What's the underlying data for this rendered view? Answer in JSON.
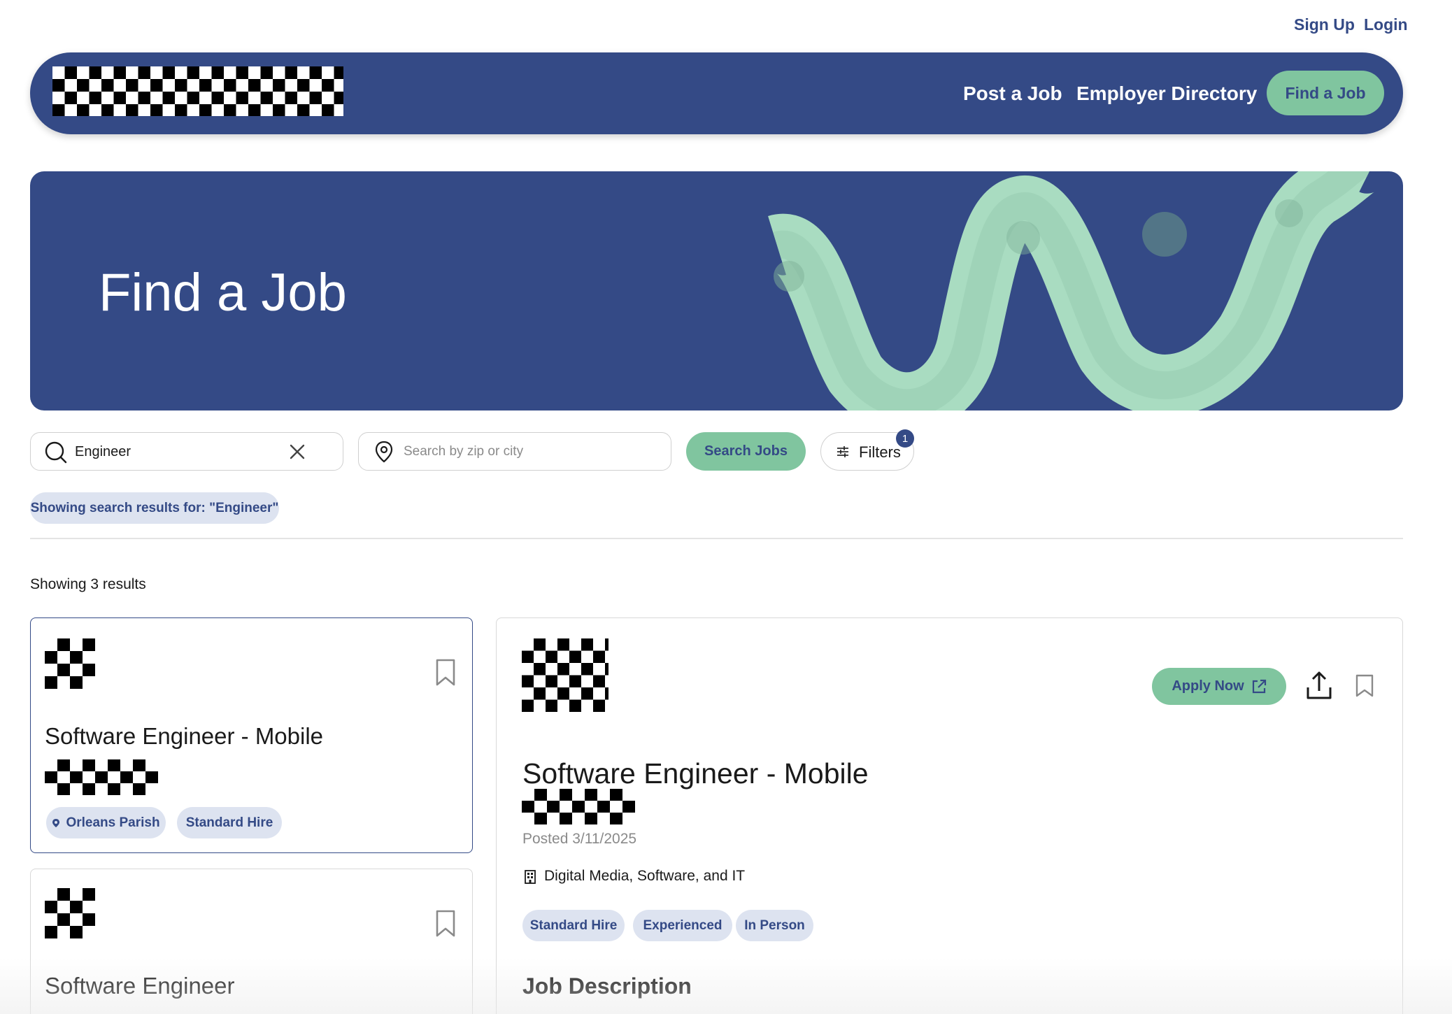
{
  "auth": {
    "signup_label": "Sign Up",
    "login_label": "Login"
  },
  "header": {
    "nav": {
      "post_job": "Post a Job",
      "employer_directory": "Employer Directory",
      "find_job": "Find a Job"
    }
  },
  "hero": {
    "title": "Find a Job"
  },
  "search": {
    "keyword_value": "Engineer",
    "location_placeholder": "Search by zip or city",
    "search_button": "Search Jobs",
    "filters_label": "Filters",
    "filters_count": "1"
  },
  "query_chip": "Showing search results for: \"Engineer\"",
  "results": {
    "count_label": "Showing 3 results",
    "cards": [
      {
        "title": "Software Engineer - Mobile",
        "location": "Orleans Parish",
        "hire_type": "Standard Hire"
      },
      {
        "title": "Software Engineer"
      }
    ]
  },
  "detail": {
    "apply_label": "Apply Now",
    "title": "Software Engineer - Mobile",
    "posted": "Posted 3/11/2025",
    "industry": "Digital Media, Software, and IT",
    "tags": [
      "Standard Hire",
      "Experienced",
      "In Person"
    ],
    "section_title": "Job Description"
  },
  "colors": {
    "brand_navy": "#344a86",
    "brand_green": "#80c59f",
    "chip_bg": "#dde3f0"
  },
  "icons": [
    "search-icon",
    "clear-icon",
    "location-pin-icon",
    "sliders-icon",
    "bookmark-icon",
    "external-link-icon",
    "share-upload-icon",
    "building-icon"
  ]
}
